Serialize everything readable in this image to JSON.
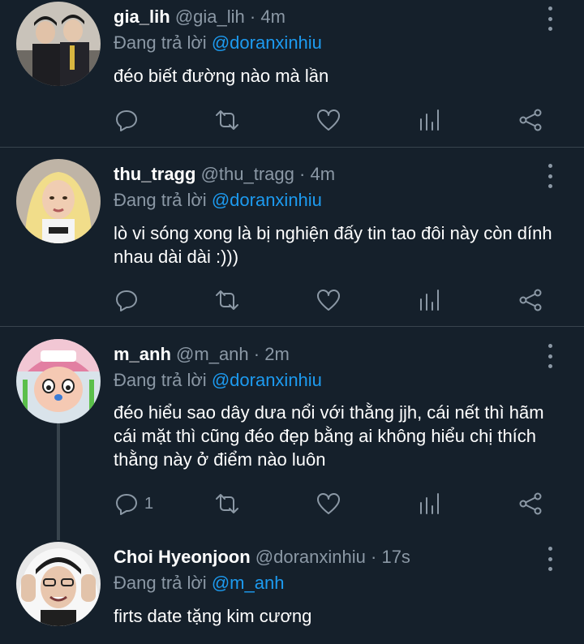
{
  "tweets": [
    {
      "name": "gia_lih",
      "handle": "@gia_lih",
      "time": "4m",
      "reply_prefix": "Đang trả lời",
      "reply_to": "@doranxinhiu",
      "text": "đéo biết đường nào mà lần",
      "reply_count": ""
    },
    {
      "name": "thu_tragg",
      "handle": "@thu_tragg",
      "time": "4m",
      "reply_prefix": "Đang trả lời",
      "reply_to": "@doranxinhiu",
      "text": "lò vi sóng xong là bị nghiện đấy tin tao đôi này còn dính nhau dài dài :)))",
      "reply_count": ""
    },
    {
      "name": "m_anh",
      "handle": "@m_anh",
      "time": "2m",
      "reply_prefix": "Đang trả lời",
      "reply_to": "@doranxinhiu",
      "text": "đéo hiểu sao dây dưa nổi với thằng jjh, cái nết thì hãm cái mặt thì cũng đéo đẹp bằng ai không hiểu chị thích thằng này ở điểm nào luôn",
      "reply_count": "1"
    },
    {
      "name": "Choi Hyeonjoon",
      "handle": "@doranxinhiu",
      "time": "17s",
      "reply_prefix": "Đang trả lời",
      "reply_to": "@m_anh",
      "text": "firts date tặng kim cương",
      "reply_count": ""
    }
  ],
  "separator": "·",
  "icons": [
    "reply-icon",
    "retweet-icon",
    "like-icon",
    "analytics-icon",
    "share-icon",
    "more-icon"
  ],
  "colors": {
    "background": "#15202b",
    "muted": "#8b98a5",
    "mention": "#1d9bf0",
    "divider": "#38444d"
  }
}
